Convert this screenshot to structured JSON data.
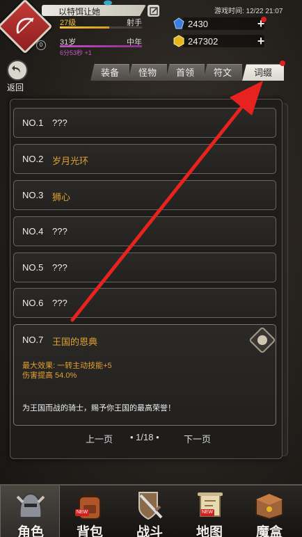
{
  "header": {
    "player_name": "以特饵让她",
    "level": "27级",
    "class_name": "射手",
    "level_progress_pct": 60,
    "age": "31岁",
    "age_stage": "中年",
    "age_progress_pct": 100,
    "age_timer": "6分53秒 +1",
    "game_time": "游戏时间: 12/22 21:07",
    "emblem_badge": "0"
  },
  "currency": {
    "gems": "2430",
    "gold": "247302"
  },
  "back": {
    "label": "返回"
  },
  "tabs": [
    {
      "label": "装备"
    },
    {
      "label": "怪物"
    },
    {
      "label": "首领"
    },
    {
      "label": "符文"
    },
    {
      "label": "词缀"
    }
  ],
  "affixes": [
    {
      "num": "NO.1",
      "name": "???"
    },
    {
      "num": "NO.2",
      "name": "岁月光环"
    },
    {
      "num": "NO.3",
      "name": "狮心"
    },
    {
      "num": "NO.4",
      "name": "???"
    },
    {
      "num": "NO.5",
      "name": "???"
    },
    {
      "num": "NO.6",
      "name": "???"
    }
  ],
  "expanded": {
    "num": "NO.7",
    "name": "王国的恩典",
    "effect1": "最大效果: 一转主动技能+5",
    "effect2": "伤害提高 54.0%",
    "desc": "为王国而战的骑士，赐予你王国的最高荣誉！"
  },
  "pager": {
    "prev": "上一页",
    "page": "• 1/18 •",
    "next": "下一页"
  },
  "nav": [
    {
      "label": "角色",
      "icon": "helmet-icon"
    },
    {
      "label": "背包",
      "icon": "backpack-icon"
    },
    {
      "label": "战斗",
      "icon": "sword-shield-icon"
    },
    {
      "label": "地图",
      "icon": "scroll-map-icon"
    },
    {
      "label": "魔盒",
      "icon": "magic-box-icon"
    }
  ],
  "new_badge": "NEW",
  "colors": {
    "accent_gold": "#e0a030",
    "emblem_red": "#c23a37",
    "annotation_red": "#e8231f"
  }
}
